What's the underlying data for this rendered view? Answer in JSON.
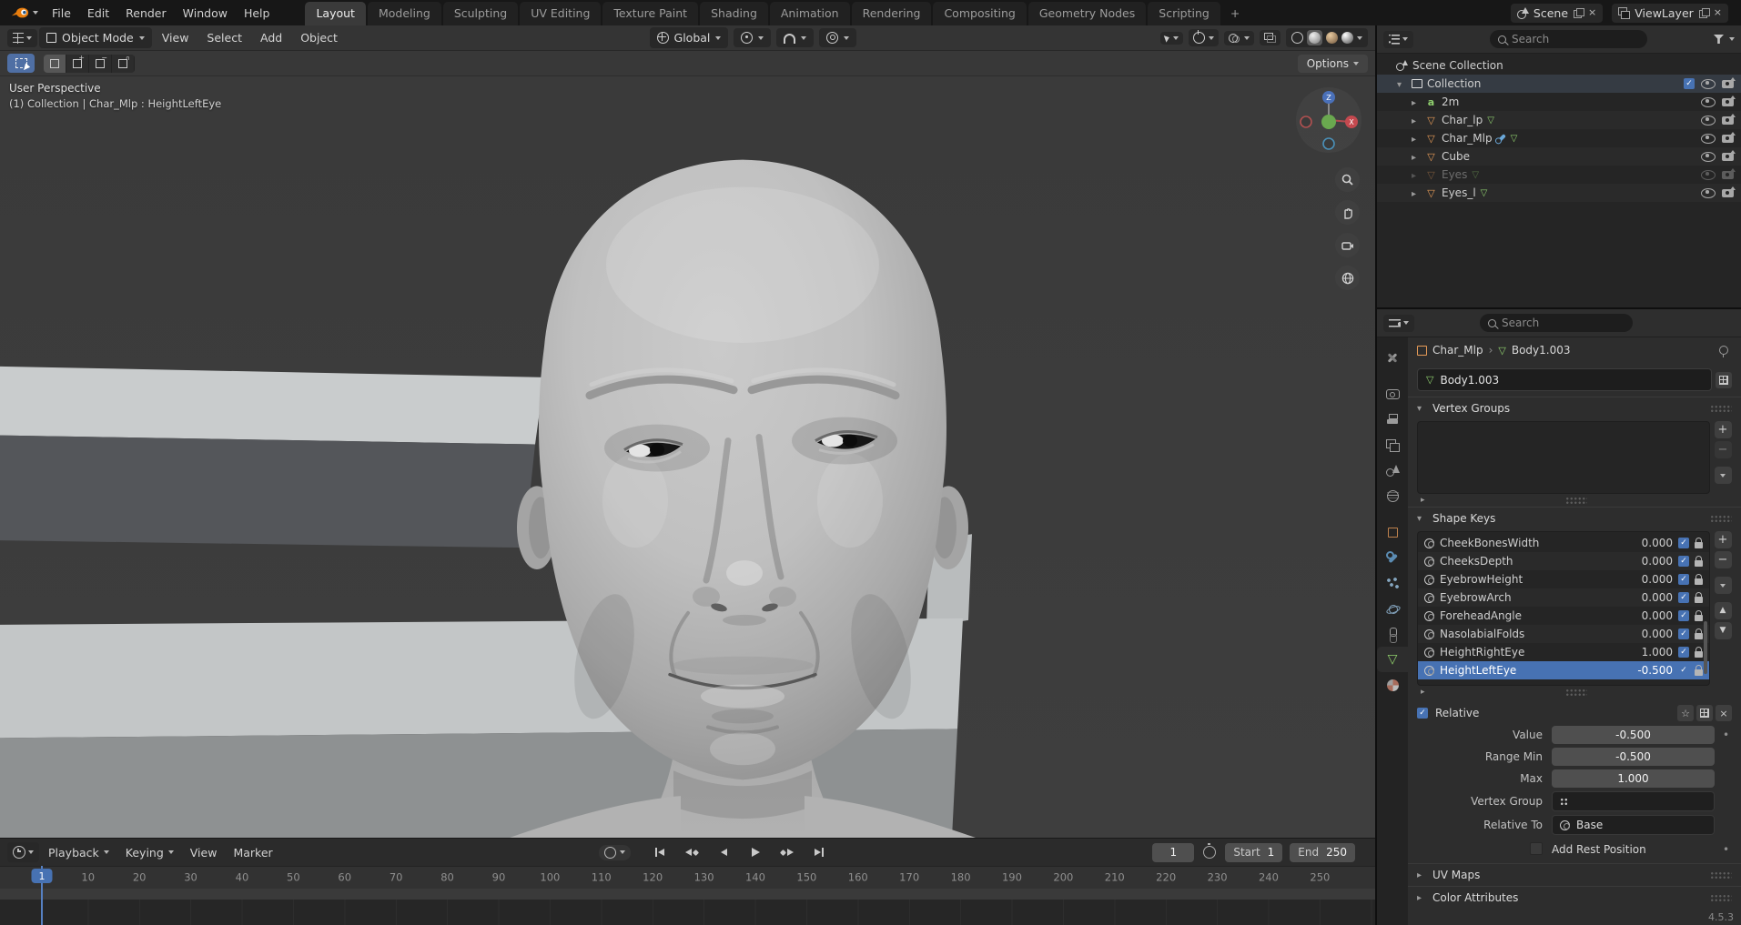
{
  "topbar": {
    "menus": [
      {
        "label": "File"
      },
      {
        "label": "Edit"
      },
      {
        "label": "Render"
      },
      {
        "label": "Window"
      },
      {
        "label": "Help"
      }
    ],
    "tabs": [
      {
        "label": "Layout",
        "active": true
      },
      {
        "label": "Modeling"
      },
      {
        "label": "Sculpting"
      },
      {
        "label": "UV Editing"
      },
      {
        "label": "Texture Paint"
      },
      {
        "label": "Shading"
      },
      {
        "label": "Animation"
      },
      {
        "label": "Rendering"
      },
      {
        "label": "Compositing"
      },
      {
        "label": "Geometry Nodes"
      },
      {
        "label": "Scripting"
      }
    ],
    "new_tab": "+",
    "scene_label": "Scene",
    "viewlayer_label": "ViewLayer"
  },
  "viewport": {
    "mode": "Object Mode",
    "menus": [
      {
        "label": "View"
      },
      {
        "label": "Select"
      },
      {
        "label": "Add"
      },
      {
        "label": "Object"
      }
    ],
    "orientation": "Global",
    "options_label": "Options",
    "overlay_line1": "User Perspective",
    "overlay_line2": "(1) Collection | Char_Mlp : HeightLeftEye",
    "gizmo_x": "X",
    "gizmo_z": "Z"
  },
  "outliner": {
    "search_placeholder": "Search",
    "rows": [
      {
        "label": "Scene Collection",
        "type": "scene",
        "depth": 0,
        "plain": true
      },
      {
        "label": "Collection",
        "type": "collection",
        "depth": 1,
        "expanded": true,
        "has_checkbox": true,
        "active": true
      },
      {
        "label": "2m",
        "type": "font",
        "depth": 2
      },
      {
        "label": "Char_lp",
        "type": "mesh",
        "depth": 2,
        "has_data": true
      },
      {
        "label": "Char_Mlp",
        "type": "mesh",
        "depth": 2,
        "has_modifier": true,
        "has_data": true
      },
      {
        "label": "Cube",
        "type": "mesh",
        "depth": 2
      },
      {
        "label": "Eyes",
        "type": "mesh",
        "depth": 2,
        "has_data": true,
        "disabled": true
      },
      {
        "label": "Eyes_l",
        "type": "mesh",
        "depth": 2,
        "has_data": true
      }
    ]
  },
  "properties": {
    "search_placeholder": "Search",
    "breadcrumb_object": "Char_Mlp",
    "breadcrumb_data": "Body1.003",
    "name_value": "Body1.003",
    "tabs": [
      {
        "id": "tool"
      },
      {
        "id": "render",
        "gap": true
      },
      {
        "id": "output"
      },
      {
        "id": "viewlayer"
      },
      {
        "id": "scene"
      },
      {
        "id": "world"
      },
      {
        "id": "object",
        "gap": true
      },
      {
        "id": "modifiers"
      },
      {
        "id": "particles"
      },
      {
        "id": "physics"
      },
      {
        "id": "constraints"
      },
      {
        "id": "data",
        "active": true
      },
      {
        "id": "material"
      }
    ],
    "section_vertex_groups": "Vertex Groups",
    "section_shape_keys": "Shape Keys",
    "section_uv_maps": "UV Maps",
    "section_color_attributes": "Color Attributes",
    "shape_keys": [
      {
        "name": "CheekBonesWidth",
        "value": "0.000"
      },
      {
        "name": "CheeksDepth",
        "value": "0.000"
      },
      {
        "name": "EyebrowHeight",
        "value": "0.000"
      },
      {
        "name": "EyebrowArch",
        "value": "0.000"
      },
      {
        "name": "ForeheadAngle",
        "value": "0.000"
      },
      {
        "name": "NasolabialFolds",
        "value": "0.000"
      },
      {
        "name": "HeightRightEye",
        "value": "1.000"
      },
      {
        "name": "HeightLeftEye",
        "value": "-0.500",
        "selected": true
      }
    ],
    "relative_label": "Relative",
    "rows": {
      "value_label": "Value",
      "value": "-0.500",
      "range_min_label": "Range Min",
      "range_min": "-0.500",
      "max_label": "Max",
      "max": "1.000",
      "vertex_group_label": "Vertex Group",
      "relative_to_label": "Relative To",
      "relative_to": "Base",
      "add_rest_label": "Add Rest Position"
    }
  },
  "timeline": {
    "menus": [
      {
        "label": "Playback",
        "caret": true
      },
      {
        "label": "Keying",
        "caret": true
      },
      {
        "label": "View"
      },
      {
        "label": "Marker"
      }
    ],
    "current_frame": "1",
    "start_label": "Start",
    "start_value": "1",
    "end_label": "End",
    "end_value": "250",
    "playhead_label": "1",
    "ticks": [
      10,
      20,
      30,
      40,
      50,
      60,
      70,
      80,
      90,
      100,
      110,
      120,
      130,
      140,
      150,
      160,
      170,
      180,
      190,
      200,
      210,
      220,
      230,
      240,
      250
    ]
  },
  "status": {
    "version": "4.5.3"
  }
}
